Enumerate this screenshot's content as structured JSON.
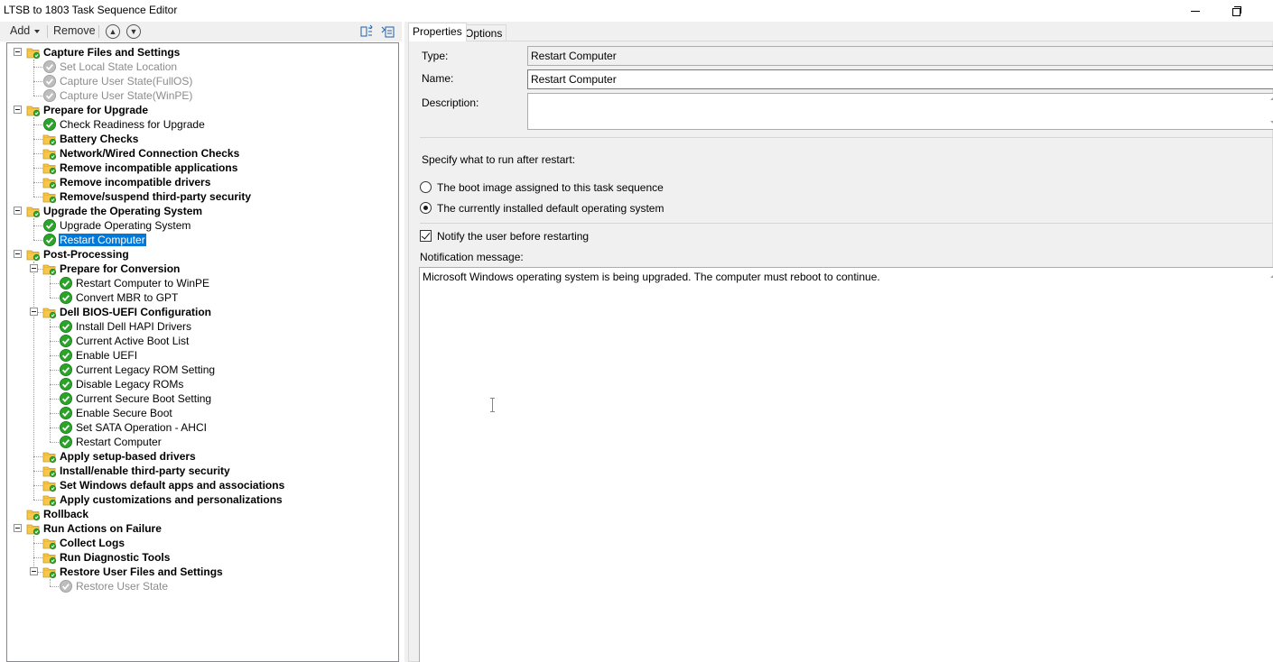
{
  "window": {
    "title": "LTSB to 1803 Task Sequence Editor"
  },
  "toolbar": {
    "add_label": "Add",
    "remove_label": "Remove",
    "move_up_icon": "move-up-icon",
    "move_down_icon": "move-down-icon"
  },
  "tree": [
    {
      "label": "Capture Files and Settings",
      "kind": "group",
      "level": 0,
      "expandable": true
    },
    {
      "label": "Set Local State Location",
      "kind": "step",
      "level": 1,
      "state": "disabled"
    },
    {
      "label": "Capture User State(FullOS)",
      "kind": "step",
      "level": 1,
      "state": "disabled"
    },
    {
      "label": "Capture User State(WinPE)",
      "kind": "step",
      "level": 1,
      "state": "disabled"
    },
    {
      "label": "Prepare for Upgrade",
      "kind": "group",
      "level": 0,
      "expandable": true
    },
    {
      "label": "Check Readiness for Upgrade",
      "kind": "step",
      "level": 1,
      "state": "ok"
    },
    {
      "label": "Battery Checks",
      "kind": "group",
      "level": 1
    },
    {
      "label": "Network/Wired Connection Checks",
      "kind": "group",
      "level": 1
    },
    {
      "label": "Remove incompatible applications",
      "kind": "group",
      "level": 1
    },
    {
      "label": "Remove incompatible drivers",
      "kind": "group",
      "level": 1
    },
    {
      "label": "Remove/suspend third-party security",
      "kind": "group",
      "level": 1
    },
    {
      "label": "Upgrade the Operating System",
      "kind": "group",
      "level": 0,
      "expandable": true
    },
    {
      "label": "Upgrade Operating System",
      "kind": "step",
      "level": 1,
      "state": "ok"
    },
    {
      "label": "Restart Computer",
      "kind": "step",
      "level": 1,
      "state": "ok",
      "selected": true
    },
    {
      "label": "Post-Processing",
      "kind": "group",
      "level": 0,
      "expandable": true
    },
    {
      "label": "Prepare for Conversion",
      "kind": "group",
      "level": 1,
      "expandable": true
    },
    {
      "label": "Restart Computer to WinPE",
      "kind": "step",
      "level": 2,
      "state": "ok"
    },
    {
      "label": "Convert MBR to GPT",
      "kind": "step",
      "level": 2,
      "state": "ok"
    },
    {
      "label": "Dell BIOS-UEFI Configuration",
      "kind": "group",
      "level": 1,
      "expandable": true
    },
    {
      "label": "Install Dell HAPI Drivers",
      "kind": "step",
      "level": 2,
      "state": "ok"
    },
    {
      "label": "Current Active Boot List",
      "kind": "step",
      "level": 2,
      "state": "ok"
    },
    {
      "label": "Enable UEFI",
      "kind": "step",
      "level": 2,
      "state": "ok"
    },
    {
      "label": "Current Legacy ROM Setting",
      "kind": "step",
      "level": 2,
      "state": "ok"
    },
    {
      "label": "Disable Legacy ROMs",
      "kind": "step",
      "level": 2,
      "state": "ok"
    },
    {
      "label": "Current Secure Boot Setting",
      "kind": "step",
      "level": 2,
      "state": "ok"
    },
    {
      "label": "Enable Secure Boot",
      "kind": "step",
      "level": 2,
      "state": "ok"
    },
    {
      "label": "Set SATA Operation - AHCI",
      "kind": "step",
      "level": 2,
      "state": "ok"
    },
    {
      "label": "Restart Computer",
      "kind": "step",
      "level": 2,
      "state": "ok"
    },
    {
      "label": "Apply setup-based drivers",
      "kind": "group",
      "level": 1
    },
    {
      "label": "Install/enable third-party security",
      "kind": "group",
      "level": 1
    },
    {
      "label": "Set Windows default apps and associations",
      "kind": "group",
      "level": 1
    },
    {
      "label": "Apply customizations and personalizations",
      "kind": "group",
      "level": 1
    },
    {
      "label": "Rollback",
      "kind": "group",
      "level": 0
    },
    {
      "label": "Run Actions on Failure",
      "kind": "group",
      "level": 0,
      "expandable": true
    },
    {
      "label": "Collect Logs",
      "kind": "group",
      "level": 1
    },
    {
      "label": "Run Diagnostic Tools",
      "kind": "group",
      "level": 1
    },
    {
      "label": "Restore User Files and Settings",
      "kind": "group",
      "level": 1,
      "expandable": true
    },
    {
      "label": "Restore User State",
      "kind": "step",
      "level": 2,
      "state": "disabled"
    }
  ],
  "tabs": [
    {
      "label": "Properties",
      "active": true
    },
    {
      "label": "Options",
      "active": false
    }
  ],
  "properties": {
    "type_label": "Type:",
    "type_value": "Restart Computer",
    "name_label": "Name:",
    "name_value": "Restart Computer",
    "description_label": "Description:",
    "description_value": "",
    "specify_label": "Specify what to run after restart:",
    "radio_boot_image": "The boot image assigned to this task sequence",
    "radio_default_os": "The currently installed default operating system",
    "selected_option": "default_os",
    "notify_label": "Notify the user before restarting",
    "notify_checked": true,
    "notification_label": "Notification message:",
    "notification_value": "Microsoft Windows operating system is being upgraded. The computer must reboot to continue."
  },
  "colors": {
    "selection": "#0078d7",
    "check_green": "#2aa52a",
    "folder_yellow": "#f4c84a",
    "disabled_text": "#8c8c8c"
  }
}
